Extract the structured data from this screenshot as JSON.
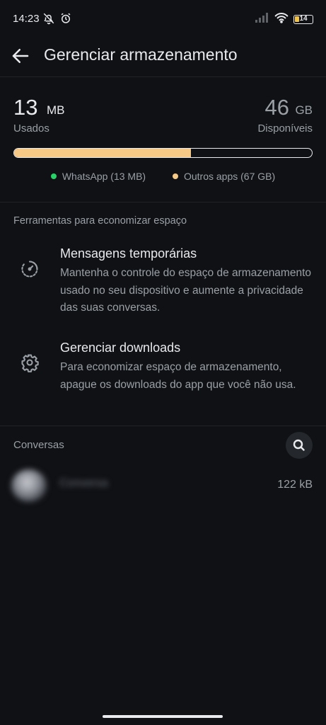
{
  "status_bar": {
    "time": "14:23",
    "battery": "14",
    "icons_left": [
      "notifications-off-icon",
      "alarm-icon"
    ],
    "icons_right": [
      "signal-icon",
      "wifi-icon",
      "battery-icon"
    ]
  },
  "app_bar": {
    "title": "Gerenciar armazenamento",
    "back_icon": "arrow-back-icon"
  },
  "storage": {
    "used_value": "13",
    "used_unit": "MB",
    "used_label": "Usados",
    "available_value": "46",
    "available_unit": "GB",
    "available_label": "Disponíveis",
    "bar_fraction_other_apps": 0.595,
    "bar_fraction_whatsapp": 0.0,
    "legend": [
      {
        "label": "WhatsApp (13 MB)",
        "color": "#25d366"
      },
      {
        "label": "Outros apps (67 GB)",
        "color": "#f6c987"
      }
    ]
  },
  "tools": {
    "header": "Ferramentas para economizar espaço",
    "items": [
      {
        "title": "Mensagens temporárias",
        "description": "Mantenha o controle do espaço de armazenamento usado no seu dispositivo e aumente a privacidade das suas conversas.",
        "icon": "timer-icon"
      },
      {
        "title": "Gerenciar downloads",
        "description": "Para economizar espaço de armazenamento, apague os downloads do app que você não usa.",
        "icon": "gear-icon"
      }
    ]
  },
  "conversations": {
    "header": "Conversas",
    "search_icon": "search-icon",
    "items": [
      {
        "name": "Conversa",
        "size": "122 kB"
      }
    ]
  },
  "colors": {
    "background": "#0f1115",
    "whatsapp_green": "#25d366",
    "other_apps": "#f6c987"
  }
}
